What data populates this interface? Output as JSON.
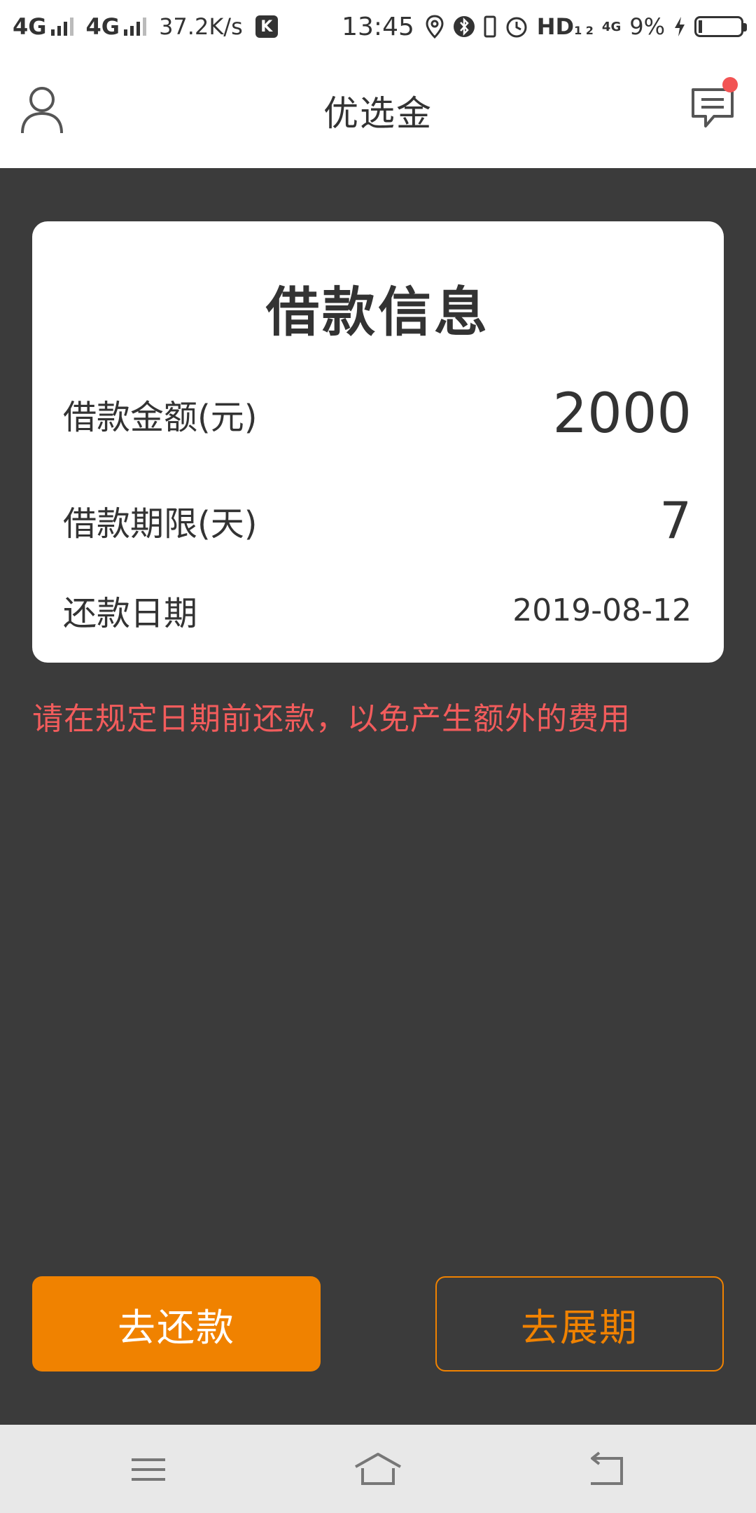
{
  "status_bar": {
    "signal_1": "4G",
    "signal_2": "4G",
    "net_speed": "37.2K/s",
    "k_badge": "K",
    "time": "13:45",
    "hd_label": "HD",
    "hd_sub": "1 2",
    "net_4g": "4G",
    "battery_pct": "9%",
    "battery_level": 0.09,
    "icons": [
      "location-icon",
      "bluetooth-icon",
      "vibrate-icon",
      "alarm-icon",
      "charging-icon"
    ]
  },
  "header": {
    "title": "优选金",
    "left_icon": "user-icon",
    "right_icon": "message-icon",
    "has_unread": true
  },
  "loan_card": {
    "title": "借款信息",
    "amount_label": "借款金额(元)",
    "amount_value": "2000",
    "term_label": "借款期限(天)",
    "term_value": "7",
    "date_label": "还款日期",
    "date_value": "2019-08-12"
  },
  "notice": "请在规定日期前还款，以免产生额外的费用",
  "actions": {
    "repay_label": "去还款",
    "extend_label": "去展期"
  },
  "nav": {
    "icons": [
      "menu-icon",
      "home-icon",
      "back-icon"
    ]
  },
  "colors": {
    "accent": "#f08200",
    "notice": "#f25c5c",
    "background": "#3b3b3b",
    "unread_dot": "#f25454"
  }
}
